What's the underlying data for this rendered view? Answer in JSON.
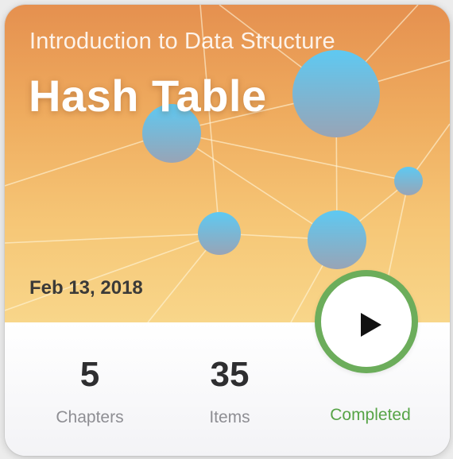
{
  "course": {
    "subtitle": "Introduction to Data Structure",
    "title": "Hash Table",
    "date": "Feb 13, 2018"
  },
  "stats": {
    "chapters": {
      "value": "5",
      "label": "Chapters"
    },
    "items": {
      "value": "35",
      "label": "Items"
    }
  },
  "status": {
    "label": "Completed",
    "action_icon": "play-icon"
  },
  "colors": {
    "status_green": "#6cad5b",
    "node_blue": "#5ec6ea",
    "hero_orange": "#e5904f"
  }
}
